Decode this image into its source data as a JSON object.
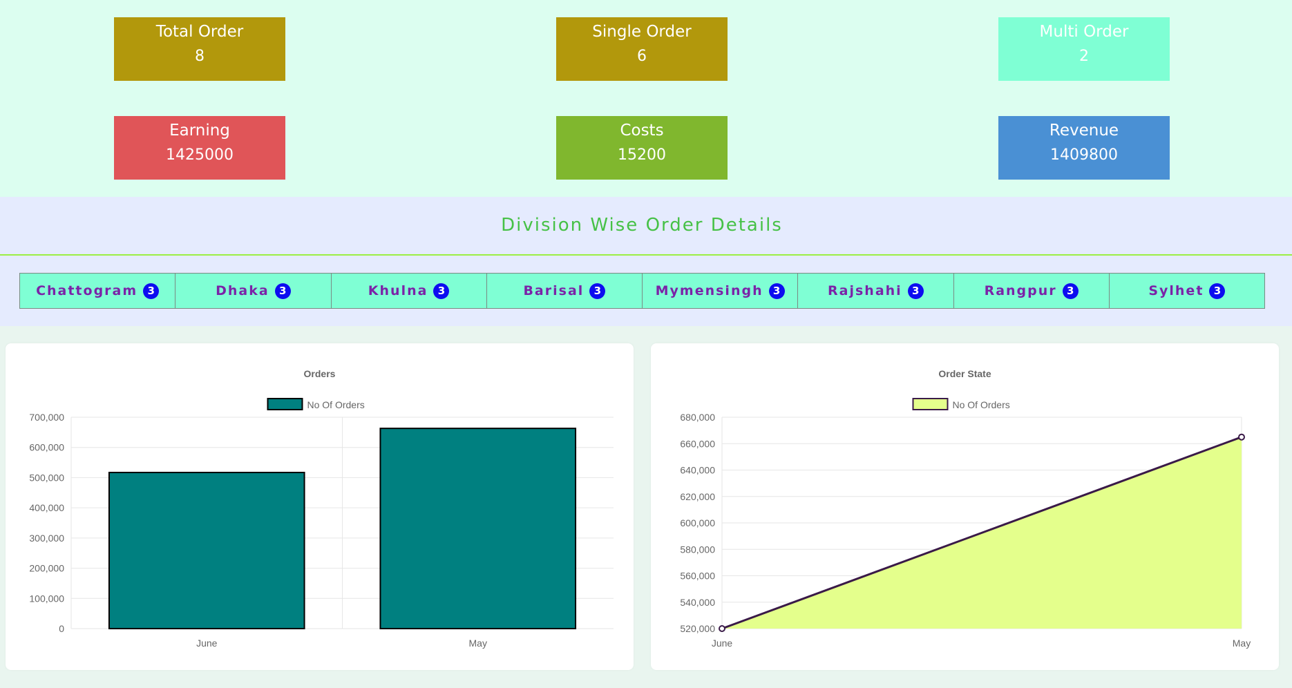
{
  "cards": [
    {
      "title": "Total Order",
      "value": "8",
      "color": "#b2980c"
    },
    {
      "title": "Single Order",
      "value": "6",
      "color": "#b2980c"
    },
    {
      "title": "Multi Order",
      "value": "2",
      "color": "#7fffd4"
    },
    {
      "title": "Earning",
      "value": "1425000",
      "color": "#e05558"
    },
    {
      "title": "Costs",
      "value": "15200",
      "color": "#80b72e"
    },
    {
      "title": "Revenue",
      "value": "1409800",
      "color": "#4a90d4"
    }
  ],
  "division": {
    "title": "Division Wise Order Details",
    "tabs": [
      {
        "label": "Chattogram",
        "count": "3"
      },
      {
        "label": "Dhaka",
        "count": "3"
      },
      {
        "label": "Khulna",
        "count": "3"
      },
      {
        "label": "Barisal",
        "count": "3"
      },
      {
        "label": "Mymensingh",
        "count": "3"
      },
      {
        "label": "Rajshahi",
        "count": "3"
      },
      {
        "label": "Rangpur",
        "count": "3"
      },
      {
        "label": "Sylhet",
        "count": "3"
      }
    ]
  },
  "chart_data": [
    {
      "type": "bar",
      "title": "Orders",
      "categories": [
        "June",
        "May"
      ],
      "series": [
        {
          "name": "No Of Orders",
          "values": [
            517000,
            663000
          ],
          "color": "#008080"
        }
      ],
      "ylim": [
        0,
        700000
      ],
      "yticks": [
        "0",
        "100,000",
        "200,000",
        "300,000",
        "400,000",
        "500,000",
        "600,000",
        "700,000"
      ],
      "legend": "top",
      "grid": true
    },
    {
      "type": "area",
      "title": "Order State",
      "categories": [
        "June",
        "May"
      ],
      "series": [
        {
          "name": "No Of Orders",
          "values": [
            520000,
            665000
          ],
          "color": "#e4ff8c",
          "line_color": "#3a1a48"
        }
      ],
      "ylim": [
        520000,
        680000
      ],
      "yticks": [
        "520,000",
        "540,000",
        "560,000",
        "580,000",
        "600,000",
        "620,000",
        "640,000",
        "660,000",
        "680,000"
      ],
      "legend": "top",
      "grid": true
    }
  ]
}
